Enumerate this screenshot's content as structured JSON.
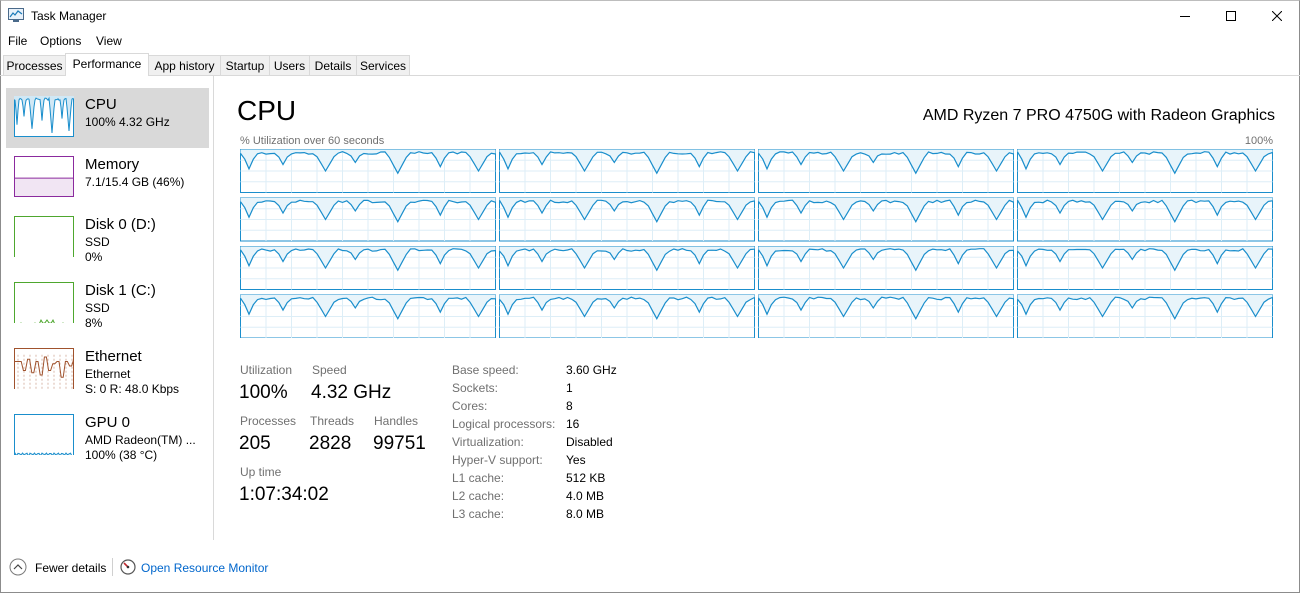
{
  "window": {
    "title": "Task Manager"
  },
  "menu": [
    "File",
    "Options",
    "View"
  ],
  "tabs": [
    "Processes",
    "Performance",
    "App history",
    "Startup",
    "Users",
    "Details",
    "Services"
  ],
  "active_tab": "Performance",
  "sidebar": [
    {
      "title": "CPU",
      "sub1": "100%  4.32 GHz",
      "sub2": "",
      "color": "#1a8ecc",
      "fill": 1.0
    },
    {
      "title": "Memory",
      "sub1": "7.1/15.4 GB (46%)",
      "sub2": "",
      "color": "#8b2a9e",
      "fill": 0.46
    },
    {
      "title": "Disk 0 (D:)",
      "sub1": "SSD",
      "sub2": "0%",
      "color": "#4ea72e",
      "fill": 0.0
    },
    {
      "title": "Disk 1 (C:)",
      "sub1": "SSD",
      "sub2": "8%",
      "color": "#4ea72e",
      "fill": 0.08
    },
    {
      "title": "Ethernet",
      "sub1": "Ethernet",
      "sub2": "S: 0  R: 48.0 Kbps",
      "color": "#a0522d",
      "fill": 0.7
    },
    {
      "title": "GPU 0",
      "sub1": "AMD Radeon(TM) ...",
      "sub2": "100% (38 °C)",
      "color": "#1a8ecc",
      "fill": 0.12
    }
  ],
  "main": {
    "title": "CPU",
    "cpu_name": "AMD Ryzen 7 PRO 4750G with Radeon Graphics",
    "graph_caption": "% Utilization over 60 seconds",
    "graph_max": "100%",
    "accent": "#1a8ecc"
  },
  "stats": {
    "utilization": {
      "label": "Utilization",
      "value": "100%"
    },
    "speed": {
      "label": "Speed",
      "value": "4.32 GHz"
    },
    "processes": {
      "label": "Processes",
      "value": "205"
    },
    "threads": {
      "label": "Threads",
      "value": "2828"
    },
    "handles": {
      "label": "Handles",
      "value": "99751"
    },
    "uptime": {
      "label": "Up time",
      "value": "1:07:34:02"
    }
  },
  "info": [
    {
      "label": "Base speed:",
      "value": "3.60 GHz"
    },
    {
      "label": "Sockets:",
      "value": "1"
    },
    {
      "label": "Cores:",
      "value": "8"
    },
    {
      "label": "Logical processors:",
      "value": "16"
    },
    {
      "label": "Virtualization:",
      "value": "Disabled"
    },
    {
      "label": "Hyper-V support:",
      "value": "Yes"
    },
    {
      "label": "L1 cache:",
      "value": "512 KB"
    },
    {
      "label": "L2 cache:",
      "value": "4.0 MB"
    },
    {
      "label": "L3 cache:",
      "value": "8.0 MB"
    }
  ],
  "footer": {
    "fewer_details": "Fewer details",
    "open_resource_monitor": "Open Resource Monitor"
  },
  "icons": {
    "app": "task-manager-icon",
    "minimize": "minimize-icon",
    "maximize": "maximize-icon",
    "close": "close-icon",
    "fewer": "chevron-up-icon",
    "resmon": "resource-monitor-icon"
  }
}
